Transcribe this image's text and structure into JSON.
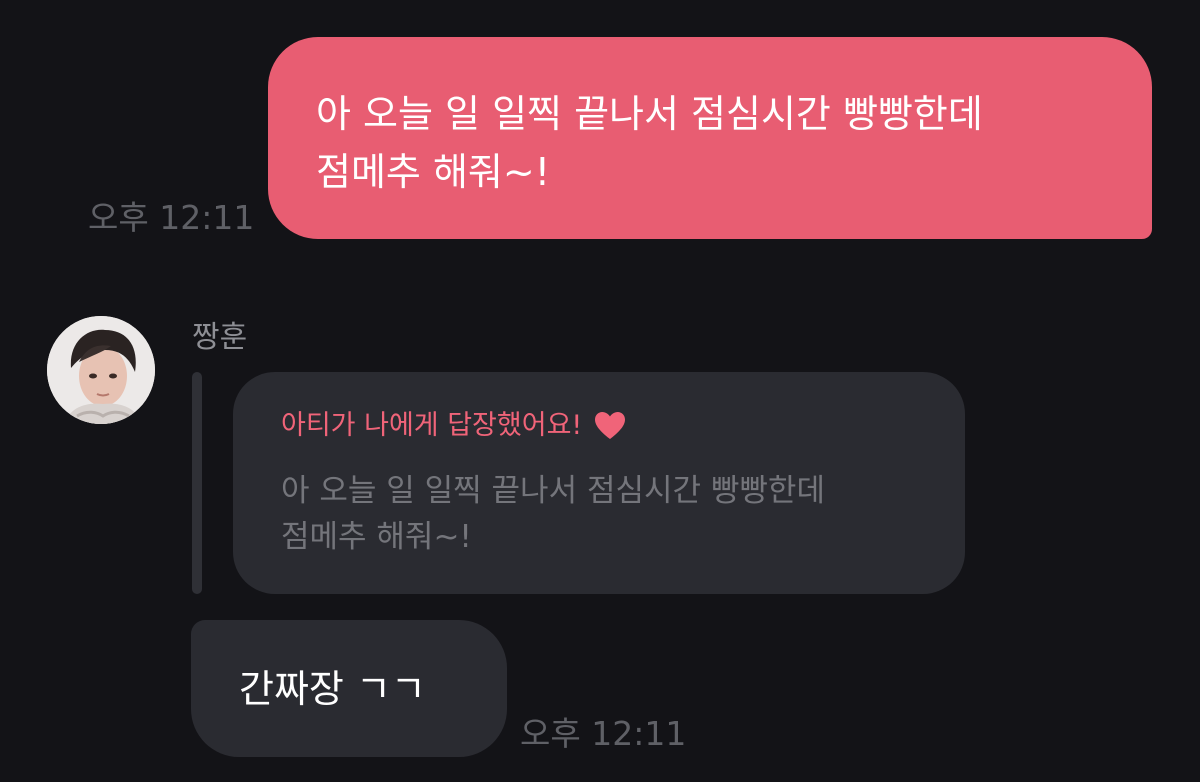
{
  "sent_message": {
    "text": "아 오늘 일 일찍 끝나서 점심시간 빵빵한데\n점메추 해줘~!",
    "time": "오후 12:11"
  },
  "received": {
    "sender_name": "짱훈",
    "reply": {
      "header": "아티가 나에게 답장했어요!",
      "quoted_text": "아 오늘 일 일찍 끝나서 점심시간 빵빵한데\n점메추 해줘~!"
    },
    "message": {
      "text": "간짜장 ㄱㄱ",
      "time": "오후 12:11"
    }
  },
  "colors": {
    "background": "#131317",
    "sent_bubble": "#e85d72",
    "received_bubble": "#2a2b31",
    "accent": "#f06479",
    "timestamp": "#5f6066"
  },
  "icons": {
    "avatar": "profile-photo",
    "reply_header": "heart-icon"
  }
}
